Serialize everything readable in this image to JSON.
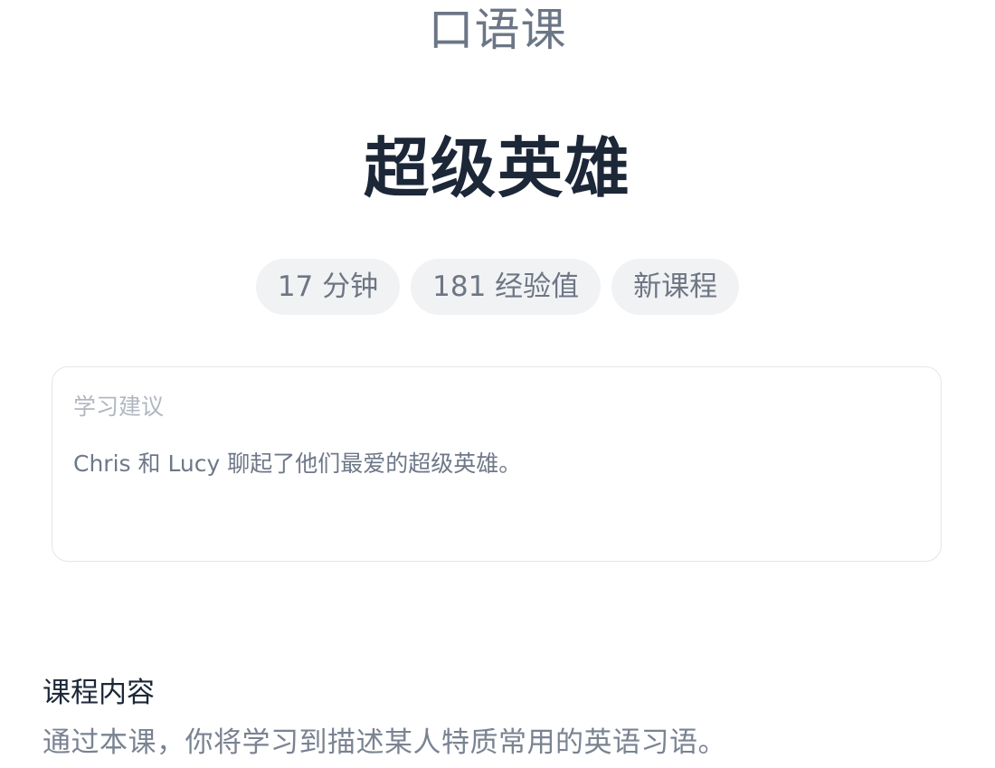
{
  "header": {
    "category": "口语课",
    "title": "超级英雄"
  },
  "tags": {
    "duration": "17 分钟",
    "xp": "181 经验值",
    "status": "新课程"
  },
  "study_tip": {
    "heading": "学习建议",
    "body": "Chris 和 Lucy 聊起了他们最爱的超级英雄。"
  },
  "course_content": {
    "heading": "课程内容",
    "body": "通过本课，你将学习到描述某人特质常用的英语习语。"
  }
}
